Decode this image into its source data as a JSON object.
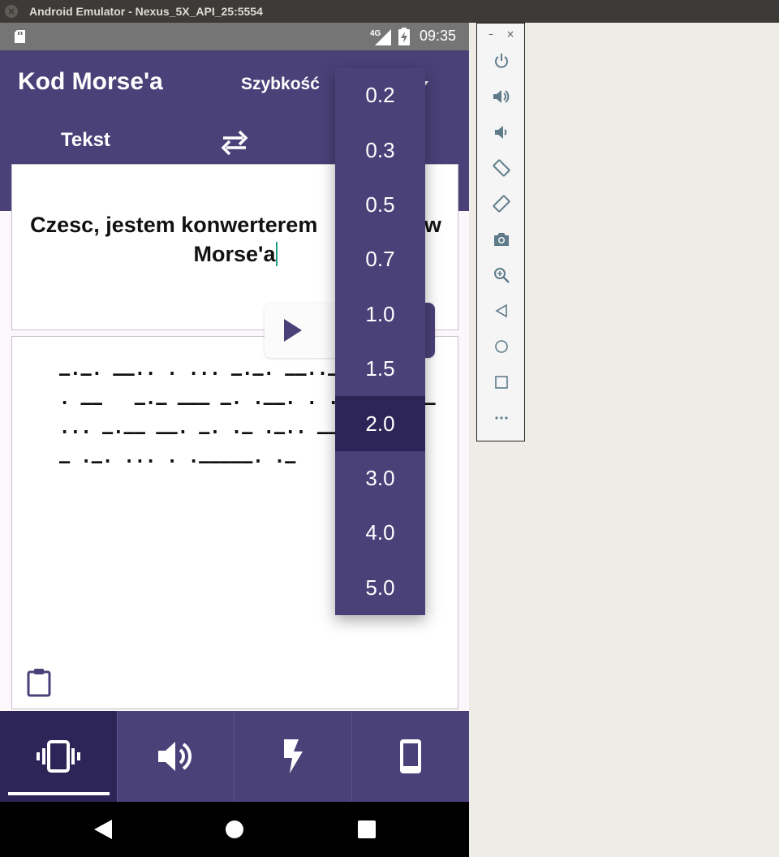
{
  "window": {
    "title": "Android Emulator - Nexus_5X_API_25:5554"
  },
  "statusbar": {
    "network": "4G",
    "time": "09:35"
  },
  "app": {
    "title": "Kod Morse'a",
    "speed_label": "Szybkość",
    "tab_left": "Tekst"
  },
  "input": {
    "line1": "Czesc, jestem konwerterem",
    "line1_tail": "ow",
    "line2": "Morse'a"
  },
  "output": {
    "morse_lines": [
      "–·–· ––·· · ··· –·–· ––··––      –",
      "· ––   –·– ––– –· ·––· · ·–· –··  –",
      "··· –·–– ––· –· ·– ·–·· ––– ·   –",
      "– ·–· ··· · ·–––––· ·–"
    ]
  },
  "speed_dropdown": {
    "options": [
      "0.2",
      "0.3",
      "0.5",
      "0.7",
      "1.0",
      "1.5",
      "2.0",
      "3.0",
      "4.0",
      "5.0"
    ],
    "selected": "2.0"
  },
  "bottom_nav": [
    "vibrate",
    "sound",
    "flash",
    "screen"
  ],
  "colors": {
    "primary": "#4b4179",
    "primary_dark": "#2d2557",
    "caret": "#1f9e8b"
  }
}
